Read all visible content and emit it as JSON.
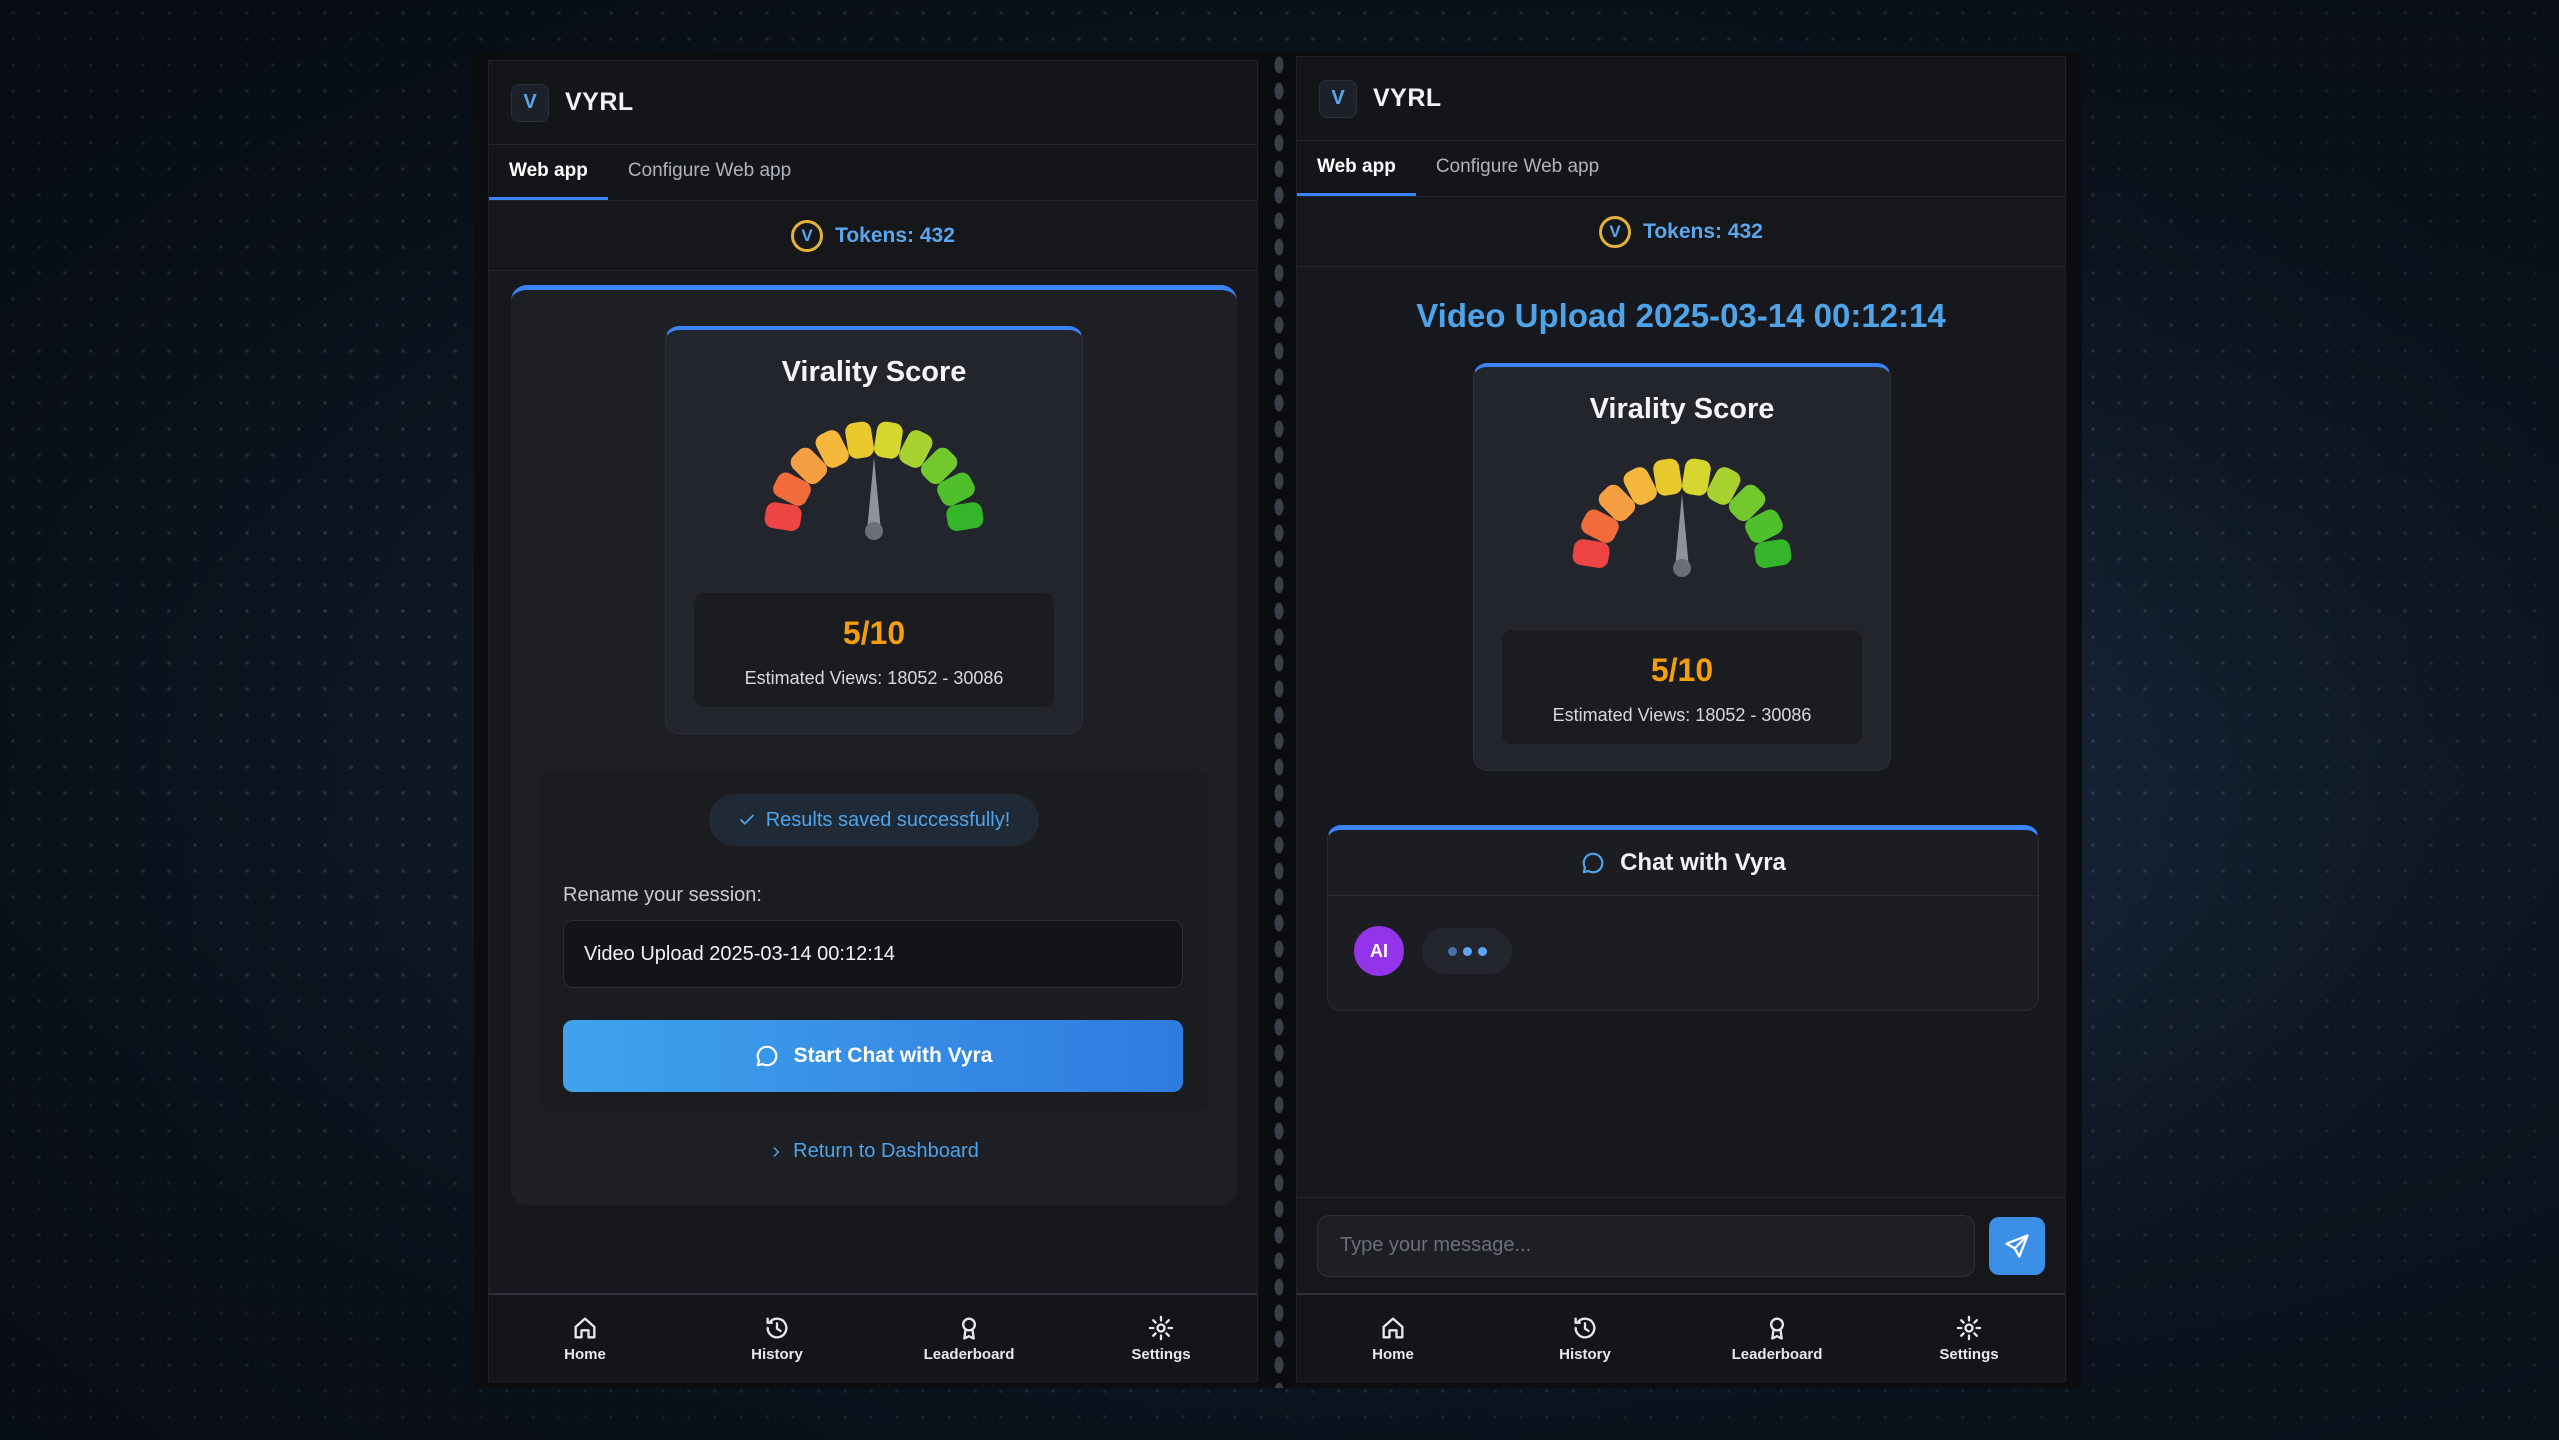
{
  "app": {
    "logo_letter": "V",
    "title": "VYRL"
  },
  "tabs": [
    "Web app",
    "Configure Web app"
  ],
  "tokens": {
    "icon_letter": "V",
    "label": "Tokens: 432"
  },
  "virality": {
    "title": "Virality Score",
    "score": "5/10",
    "score_value": 5,
    "score_max": 10,
    "estimated_views": "Estimated Views: 18052 - 30086"
  },
  "left_panel": {
    "saved_message": "Results saved successfully!",
    "rename_label": "Rename your session:",
    "session_name": "Video Upload 2025-03-14 00:12:14",
    "start_chat_label": "Start Chat with Vyra",
    "return_label": "Return to Dashboard"
  },
  "right_panel": {
    "video_title": "Video Upload 2025-03-14 00:12:14",
    "chat_title": "Chat with Vyra",
    "ai_avatar_label": "AI",
    "message_placeholder": "Type your message..."
  },
  "nav": [
    {
      "label": "Home",
      "icon": "home-icon"
    },
    {
      "label": "History",
      "icon": "history-icon"
    },
    {
      "label": "Leaderboard",
      "icon": "leaderboard-icon"
    },
    {
      "label": "Settings",
      "icon": "settings-icon"
    }
  ],
  "colors": {
    "accent": "#3b82f6",
    "link": "#4fa3e8",
    "score": "#f59e0b",
    "ai_avatar": "#9333ea"
  }
}
